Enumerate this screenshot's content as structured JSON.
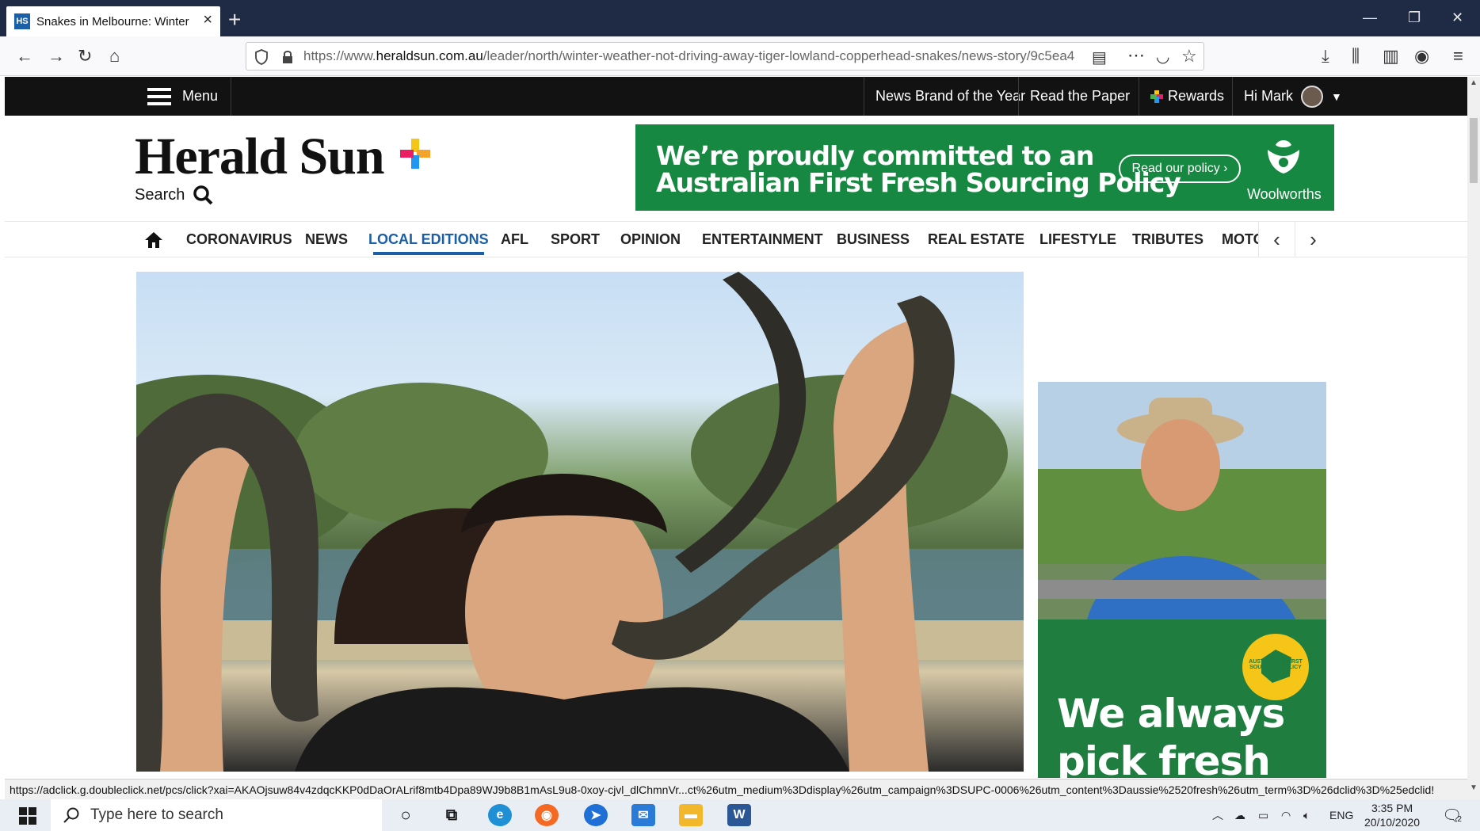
{
  "browser": {
    "tab": {
      "favicon_text": "HS",
      "title": "Snakes in Melbourne: Winter we",
      "close": "×"
    },
    "new_tab": "+",
    "window_controls": {
      "minimize": "—",
      "restore": "❐",
      "close": "✕"
    },
    "url_prefix": "https://www.",
    "url_domain": "heraldsun.com.au",
    "url_path": "/leader/north/winter-weather-not-driving-away-tiger-lowland-copperhead-snakes/news-story/9c5ea4",
    "status_url": "https://adclick.g.doubleclick.net/pcs/click?xai=AKAOjsuw84v4zdqcKKP0dDaOrALrif8mtb4Dpa89WJ9b8B1mAsL9u8-0xoy-cjvl_dlChmnVr...ct%26utm_medium%3Ddisplay%26utm_campaign%3DSUPC-0006%26utm_content%3Daussie%2520fresh%26utm_term%3D%26dclid%3D%25edclid!"
  },
  "site": {
    "menu_label": "Menu",
    "top_links": [
      "News Brand of the Year",
      "Read the Paper",
      "Rewards",
      "Hi Mark"
    ],
    "logo": "Herald Sun",
    "search_label": "Search",
    "ad_top": {
      "line1": "We’re proudly committed to an",
      "line2": "Australian First Fresh Sourcing Policy",
      "button": "Read our policy ›",
      "brand": "Woolworths"
    },
    "sections": [
      "CORONAVIRUS",
      "NEWS",
      "LOCAL EDITIONS",
      "AFL",
      "SPORT",
      "OPINION",
      "ENTERTAINMENT",
      "BUSINESS",
      "REAL ESTATE",
      "LIFESTYLE",
      "TRIBUTES",
      "MOTO"
    ],
    "active_section": "LOCAL EDITIONS",
    "side_ad": {
      "line1": "We always",
      "line2": "pick fresh",
      "badge": "AUSTRALIAN FIRST SOURCING POLICY"
    }
  },
  "taskbar": {
    "search_placeholder": "Type here to search",
    "language": "ENG",
    "time": "3:35 PM",
    "date": "20/10/2020",
    "notification_count": "2"
  },
  "colors": {
    "brand_blue": "#1b5fa8",
    "site_header": "#121212",
    "ad_green": "#178841",
    "tab_bar": "#1f2a44"
  }
}
